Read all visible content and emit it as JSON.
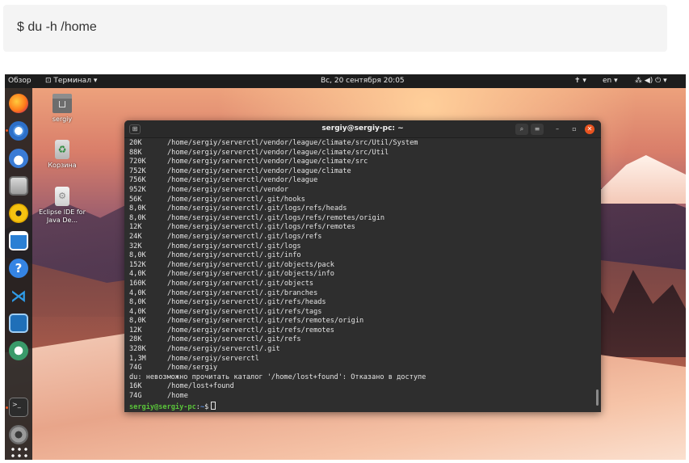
{
  "command": "$ du -h /home",
  "topbar": {
    "activities": "Обзор",
    "app_menu": "Терминал",
    "datetime": "Вс, 20 сентября  20:05",
    "accessibility": "♿",
    "lang": "en",
    "sys_icons": "⚡ ◀) ⏻"
  },
  "desktop_icons": [
    {
      "label": "sergiy"
    },
    {
      "label": "Корзина"
    },
    {
      "label": "Eclipse IDE for Java De..."
    }
  ],
  "terminal": {
    "title": "sergiy@sergiy-pc: ~",
    "lines": [
      {
        "size": "20K",
        "path": "/home/sergiy/serverctl/vendor/league/climate/src/Util/System"
      },
      {
        "size": "88K",
        "path": "/home/sergiy/serverctl/vendor/league/climate/src/Util"
      },
      {
        "size": "720K",
        "path": "/home/sergiy/serverctl/vendor/league/climate/src"
      },
      {
        "size": "752K",
        "path": "/home/sergiy/serverctl/vendor/league/climate"
      },
      {
        "size": "756K",
        "path": "/home/sergiy/serverctl/vendor/league"
      },
      {
        "size": "952K",
        "path": "/home/sergiy/serverctl/vendor"
      },
      {
        "size": "56K",
        "path": "/home/sergiy/serverctl/.git/hooks"
      },
      {
        "size": "8,0K",
        "path": "/home/sergiy/serverctl/.git/logs/refs/heads"
      },
      {
        "size": "8,0K",
        "path": "/home/sergiy/serverctl/.git/logs/refs/remotes/origin"
      },
      {
        "size": "12K",
        "path": "/home/sergiy/serverctl/.git/logs/refs/remotes"
      },
      {
        "size": "24K",
        "path": "/home/sergiy/serverctl/.git/logs/refs"
      },
      {
        "size": "32K",
        "path": "/home/sergiy/serverctl/.git/logs"
      },
      {
        "size": "8,0K",
        "path": "/home/sergiy/serverctl/.git/info"
      },
      {
        "size": "152K",
        "path": "/home/sergiy/serverctl/.git/objects/pack"
      },
      {
        "size": "4,0K",
        "path": "/home/sergiy/serverctl/.git/objects/info"
      },
      {
        "size": "160K",
        "path": "/home/sergiy/serverctl/.git/objects"
      },
      {
        "size": "4,0K",
        "path": "/home/sergiy/serverctl/.git/branches"
      },
      {
        "size": "8,0K",
        "path": "/home/sergiy/serverctl/.git/refs/heads"
      },
      {
        "size": "4,0K",
        "path": "/home/sergiy/serverctl/.git/refs/tags"
      },
      {
        "size": "8,0K",
        "path": "/home/sergiy/serverctl/.git/refs/remotes/origin"
      },
      {
        "size": "12K",
        "path": "/home/sergiy/serverctl/.git/refs/remotes"
      },
      {
        "size": "28K",
        "path": "/home/sergiy/serverctl/.git/refs"
      },
      {
        "size": "328K",
        "path": "/home/sergiy/serverctl/.git"
      },
      {
        "size": "1,3M",
        "path": "/home/sergiy/serverctl"
      },
      {
        "size": "74G",
        "path": "/home/sergiy"
      }
    ],
    "error": "du: невозможно прочитать каталог '/home/lost+found': Отказано в доступе",
    "tail": [
      {
        "size": "16K",
        "path": "/home/lost+found"
      },
      {
        "size": "74G",
        "path": "/home"
      }
    ],
    "prompt_user": "sergiy@sergiy-pc",
    "prompt_sep": ":",
    "prompt_path": "~",
    "prompt_symbol": "$"
  },
  "colors": {
    "terminal_bg": "#2e2e2e",
    "prompt_user": "#5ac53a",
    "prompt_path": "#5a8ad8",
    "accent": "#e95420"
  }
}
